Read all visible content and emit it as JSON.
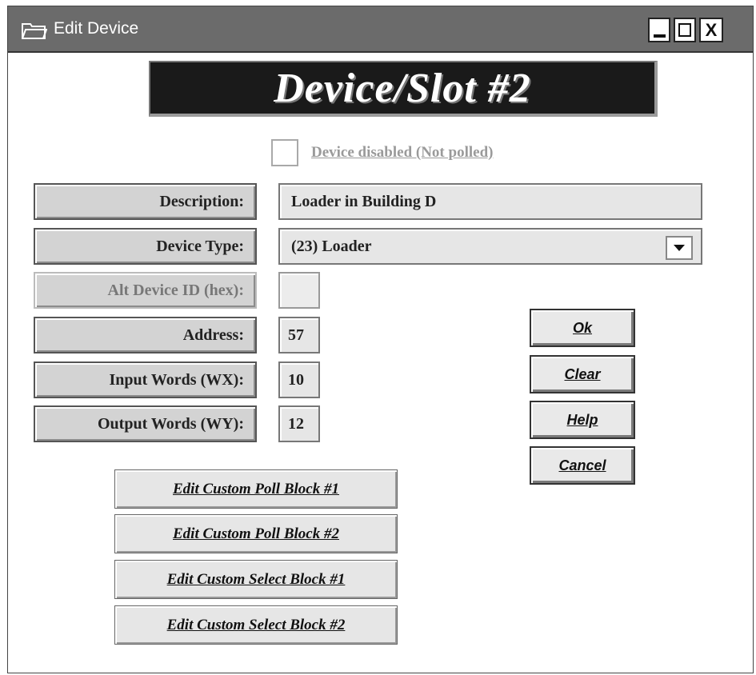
{
  "window": {
    "title": "Edit Device",
    "icon": "folder-icon",
    "controls": [
      "minimize-icon",
      "maximize-icon",
      "close-icon"
    ],
    "close_glyph": "X"
  },
  "banner": {
    "text": "Device/Slot #2"
  },
  "disabled_checkbox": {
    "label": "Device disabled (Not polled)",
    "checked": false
  },
  "fields": {
    "description": {
      "label": "Description:",
      "value": "Loader in Building D"
    },
    "device_type": {
      "label": "Device Type:",
      "value": "(23) Loader"
    },
    "alt_device_id": {
      "label": "Alt Device ID (hex):",
      "value": "",
      "enabled": false
    },
    "address": {
      "label": "Address:",
      "value": "57"
    },
    "input_words": {
      "label": "Input Words (WX):",
      "value": "10"
    },
    "output_words": {
      "label": "Output Words (WY):",
      "value": "12"
    }
  },
  "buttons": {
    "ok": "Ok",
    "clear": "Clear",
    "help": "Help",
    "cancel": "Cancel"
  },
  "block_buttons": [
    "Edit Custom Poll Block #1",
    "Edit Custom Poll Block #2",
    "Edit Custom Select Block #1",
    "Edit Custom Select Block #2"
  ],
  "colors": {
    "titlebar": "#6b6b6b",
    "banner_bg": "#1a1a1a",
    "panel_gray": "#d3d3d3",
    "disabled_text": "#9a9a9a"
  }
}
